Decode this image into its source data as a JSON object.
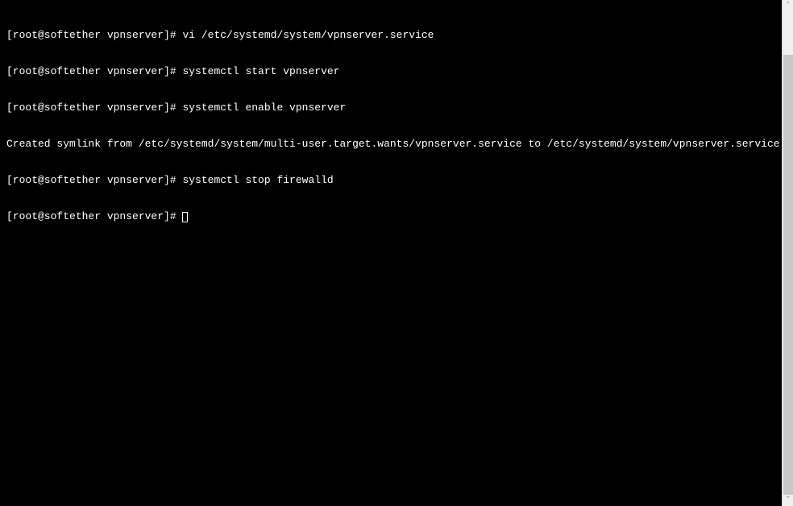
{
  "prompt": "[root@softether vpnserver]# ",
  "lines": [
    {
      "prompt": true,
      "cmd": "vi /etc/systemd/system/vpnserver.service"
    },
    {
      "prompt": true,
      "cmd": "systemctl start vpnserver"
    },
    {
      "prompt": true,
      "cmd": "systemctl enable vpnserver"
    },
    {
      "prompt": false,
      "text": "Created symlink from /etc/systemd/system/multi-user.target.wants/vpnserver.service to /etc/systemd/system/vpnserver.service."
    },
    {
      "prompt": true,
      "cmd": "systemctl stop firewalld"
    },
    {
      "prompt": true,
      "cmd": "",
      "cursor": true
    }
  ],
  "scroll": {
    "up_glyph": "ˆ",
    "down_glyph": "ˇ"
  }
}
